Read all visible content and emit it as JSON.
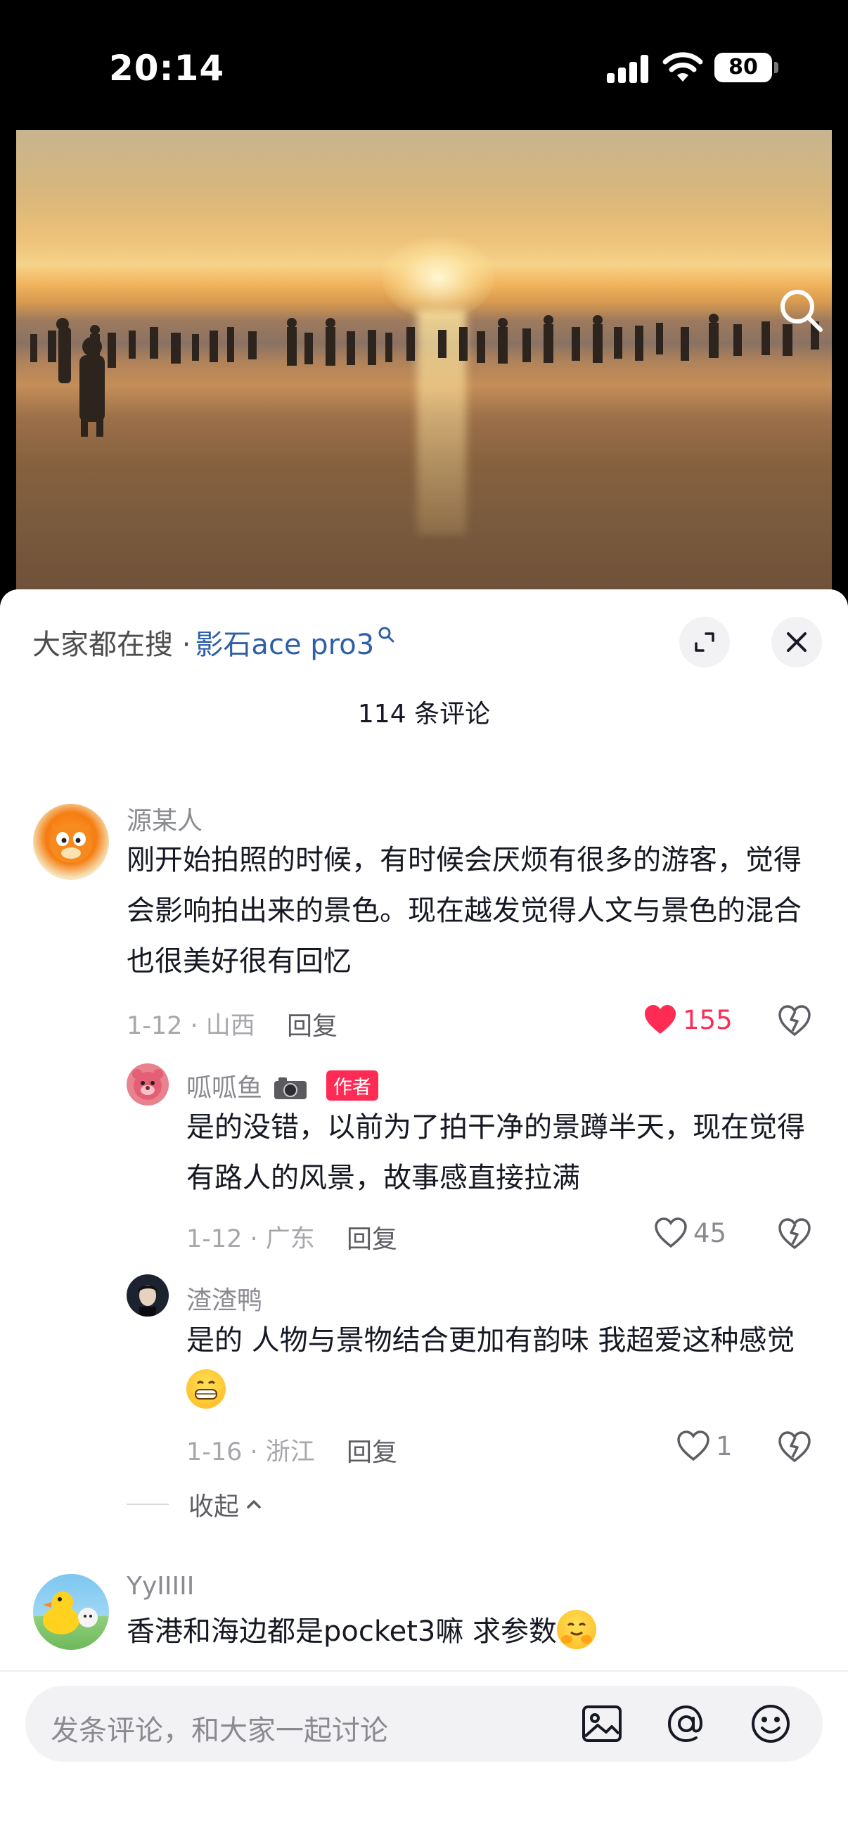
{
  "status_bar": {
    "time": "20:14",
    "battery": "80"
  },
  "search_bar": {
    "prefix": "大家都在搜 ·",
    "keyword": "影石ace pro3"
  },
  "comments_header": {
    "count_label": "114 条评论"
  },
  "comments": [
    {
      "user": "源某人",
      "text": "刚开始拍照的时候，有时候会厌烦有很多的游客，觉得会影响拍出来的景色。现在越发觉得人文与景色的混合也很美好很有回忆",
      "meta": "1-12 · 山西",
      "reply_label": "回复",
      "likes": "155",
      "liked": true,
      "replies": [
        {
          "user": "呱呱鱼",
          "badge": "作者",
          "text": "是的没错，以前为了拍干净的景蹲半天，现在觉得有路人的风景，故事感直接拉满",
          "meta": "1-12 · 广东",
          "reply_label": "回复",
          "likes": "45"
        },
        {
          "user": "渣渣鸭",
          "text": "是的 人物与景物结合更加有韵味 我超爱这种感觉",
          "meta": "1-16 · 浙江",
          "reply_label": "回复",
          "likes": "1"
        }
      ],
      "collapse_label": "收起"
    },
    {
      "user": "YyIIIII",
      "text": "香港和海边都是pocket3嘛 求参数"
    }
  ],
  "input": {
    "placeholder": "发条评论，和大家一起讨论"
  },
  "colors": {
    "accent": "#fe2c55",
    "link": "#2f5fa8"
  },
  "icons": [
    "search-icon",
    "expand-icon",
    "close-icon",
    "heart-icon",
    "dislike-icon",
    "image-icon",
    "at-icon",
    "emoji-icon"
  ]
}
